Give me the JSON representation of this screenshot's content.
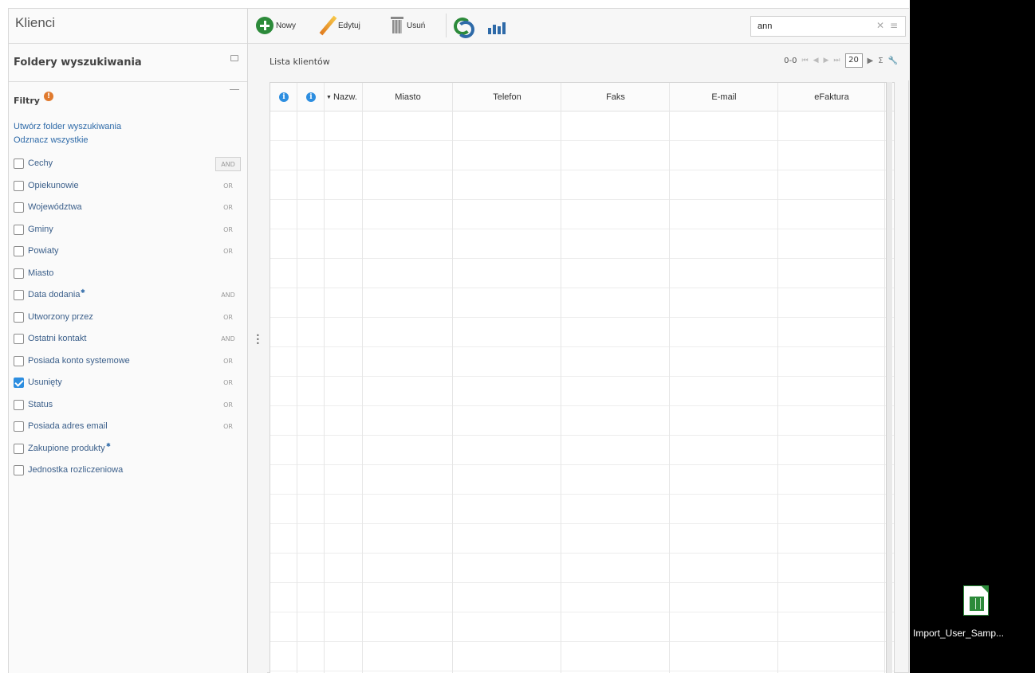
{
  "app": {
    "title": "Klienci"
  },
  "left": {
    "folders_title": "Foldery wyszukiwania",
    "filters_title": "Filtry",
    "filters_badge": "!",
    "link_create": "Utwórz folder wyszukiwania",
    "link_uncheck": "Odznacz wszystkie",
    "filters": [
      {
        "label": "Cechy",
        "op": "AND",
        "checked": false,
        "star": false
      },
      {
        "label": "Opiekunowie",
        "op": "OR",
        "checked": false,
        "star": false
      },
      {
        "label": "Województwa",
        "op": "OR",
        "checked": false,
        "star": false
      },
      {
        "label": "Gminy",
        "op": "OR",
        "checked": false,
        "star": false
      },
      {
        "label": "Powiaty",
        "op": "OR",
        "checked": false,
        "star": false
      },
      {
        "label": "Miasto",
        "op": "",
        "checked": false,
        "star": false
      },
      {
        "label": "Data dodania",
        "op": "AND",
        "checked": false,
        "star": true
      },
      {
        "label": "Utworzony przez",
        "op": "OR",
        "checked": false,
        "star": false
      },
      {
        "label": "Ostatni kontakt",
        "op": "AND",
        "checked": false,
        "star": false
      },
      {
        "label": "Posiada konto systemowe",
        "op": "OR",
        "checked": false,
        "star": false
      },
      {
        "label": "Usunięty",
        "op": "OR",
        "checked": true,
        "star": false
      },
      {
        "label": "Status",
        "op": "OR",
        "checked": false,
        "star": false
      },
      {
        "label": "Posiada adres email",
        "op": "OR",
        "checked": false,
        "star": false
      },
      {
        "label": "Zakupione produkty",
        "op": "",
        "checked": false,
        "star": true
      },
      {
        "label": "Jednostka rozliczeniowa",
        "op": "",
        "checked": false,
        "star": false
      }
    ]
  },
  "toolbar": {
    "new_label": "Nowy",
    "edit_label": "Edytuj",
    "delete_label": "Usuń"
  },
  "search": {
    "value": "ann",
    "clear": "✕",
    "menu": "≡"
  },
  "grid": {
    "title": "Lista klientów",
    "pager": {
      "range": "0-0",
      "page_size": "20",
      "sum": "Σ"
    },
    "columns": [
      "Nazw.",
      "Miasto",
      "Telefon",
      "Faks",
      "E-mail",
      "eFaktura"
    ]
  },
  "desktop": {
    "file_label": "Import_User_Samp..."
  },
  "colors": {
    "accent_blue": "#2d8ee0",
    "green": "#2c8a3a",
    "link": "#2e6aa8"
  }
}
